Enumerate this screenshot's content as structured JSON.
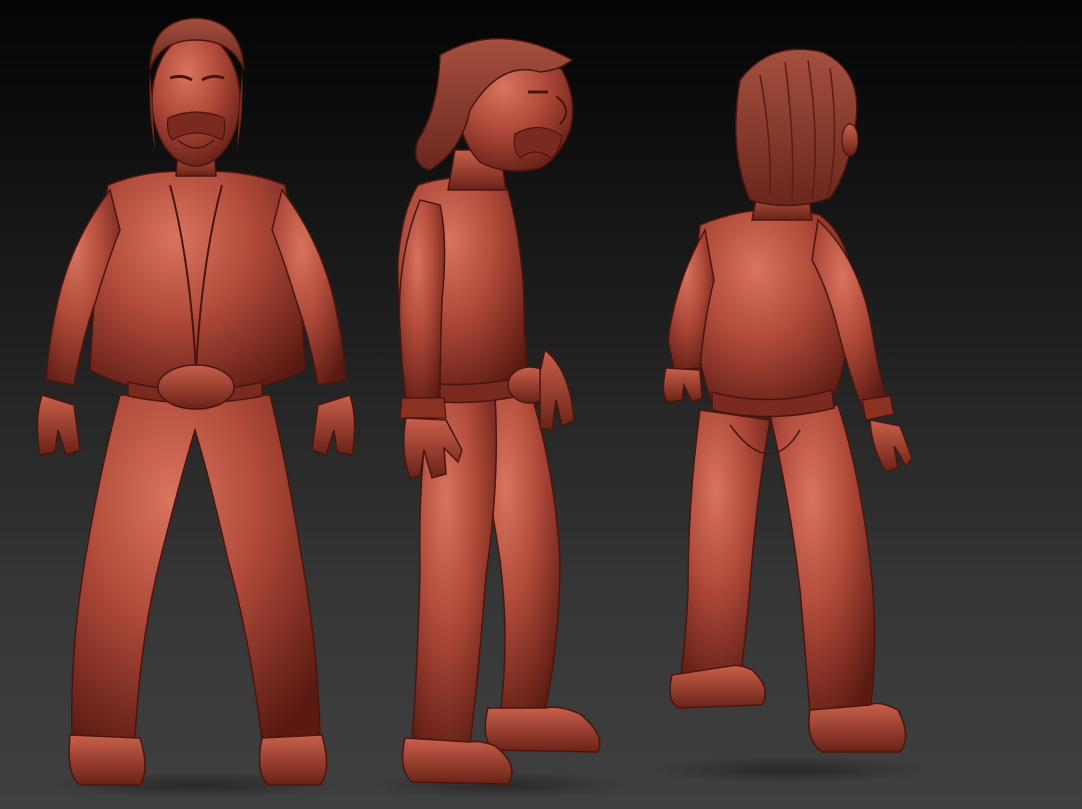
{
  "scene": {
    "background_top": "#040404",
    "background_bottom": "#404040",
    "material_color": "#b04a3a",
    "material_shadow": "#4a1510",
    "views": [
      {
        "name": "front-view"
      },
      {
        "name": "side-view"
      },
      {
        "name": "back-view"
      }
    ]
  }
}
